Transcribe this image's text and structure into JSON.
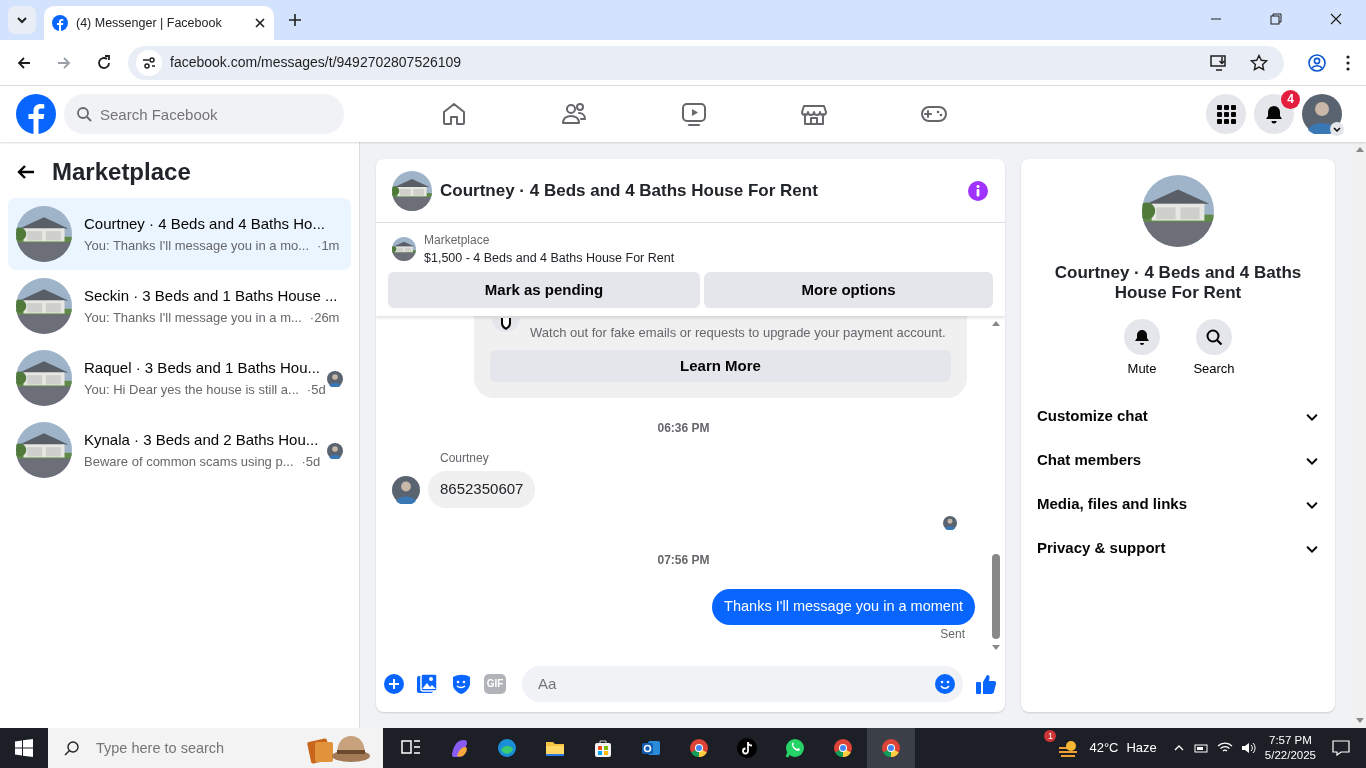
{
  "browser": {
    "tabs": [
      {
        "title": "(4) Messenger | Facebook",
        "selected": true
      }
    ],
    "url": "facebook.com/messages/t/9492702807526109"
  },
  "header": {
    "search_placeholder": "Search Facebook",
    "nav": [
      {
        "kind": "home"
      },
      {
        "kind": "friends"
      },
      {
        "kind": "video"
      },
      {
        "kind": "marketplace"
      },
      {
        "kind": "gaming"
      }
    ],
    "notifications_badge": "4"
  },
  "sidebar": {
    "title": "Marketplace",
    "conversations": [
      {
        "title": "Courtney · 4 Beds and 4 Baths Ho...",
        "preview": "You: Thanks I'll message you in a mo...",
        "time": "·1m",
        "selected": true,
        "seen": false
      },
      {
        "title": "Seckin · 3 Beds and 1 Baths House ...",
        "preview": "You: Thanks I'll message you in a m...",
        "time": "·26m",
        "selected": false,
        "seen": false
      },
      {
        "title": "Raquel · 3 Beds and 1 Baths Hou...",
        "preview": "You: Hi Dear yes the house is still a...",
        "time": "·5d",
        "selected": false,
        "seen": true
      },
      {
        "title": "Kynala · 3 Beds and 2 Baths Hou...",
        "preview": "Beware of common scams using p...",
        "time": "·5d",
        "selected": false,
        "seen": true
      }
    ]
  },
  "chat": {
    "title": "Courtney · 4 Beds and 4 Baths House For Rent",
    "listing": {
      "label": "Marketplace",
      "text": "$1,500 - 4 Beds and 4 Baths House For Rent"
    },
    "actions": [
      "Mark as pending",
      "More options"
    ],
    "notice": {
      "text": "Watch out for fake emails or requests to upgrade your payment account.",
      "button": "Learn More"
    },
    "messages": [
      {
        "kind": "time",
        "text": "06:36 PM"
      },
      {
        "kind": "received",
        "sender": "Courtney",
        "text": "8652350607"
      },
      {
        "kind": "seen"
      },
      {
        "kind": "time",
        "text": "07:56 PM"
      },
      {
        "kind": "sent",
        "text": "Thanks I'll message you in a moment",
        "status": "Sent"
      }
    ],
    "composer": {
      "placeholder": "Aa",
      "gif": "GIF"
    }
  },
  "details": {
    "title": "Courtney · 4 Beds and 4 Baths House For Rent",
    "actions": [
      "Mute",
      "Search"
    ],
    "sections": [
      {
        "label": "Customize chat",
        "expanded": false
      },
      {
        "label": "Chat members",
        "expanded": false
      },
      {
        "label": "Media, files and links",
        "expanded": false
      },
      {
        "label": "Privacy & support",
        "expanded": false
      }
    ]
  },
  "taskbar": {
    "search_placeholder": "Type here to search",
    "apps": [
      {
        "kind": "taskview",
        "selected": false
      },
      {
        "kind": "copilot",
        "selected": false
      },
      {
        "kind": "edge",
        "selected": false
      },
      {
        "kind": "explorer",
        "selected": false
      },
      {
        "kind": "store",
        "selected": false
      },
      {
        "kind": "outlook",
        "selected": false
      },
      {
        "kind": "chrome",
        "selected": false
      },
      {
        "kind": "tiktok",
        "selected": false
      },
      {
        "kind": "whatsapp",
        "selected": false
      },
      {
        "kind": "chrome",
        "selected": false
      },
      {
        "kind": "chrome",
        "selected": true
      }
    ],
    "weather": {
      "badge": "1",
      "temp": "42°C",
      "condition": "Haze"
    },
    "time": "7:57 PM",
    "date": "5/22/2025"
  }
}
